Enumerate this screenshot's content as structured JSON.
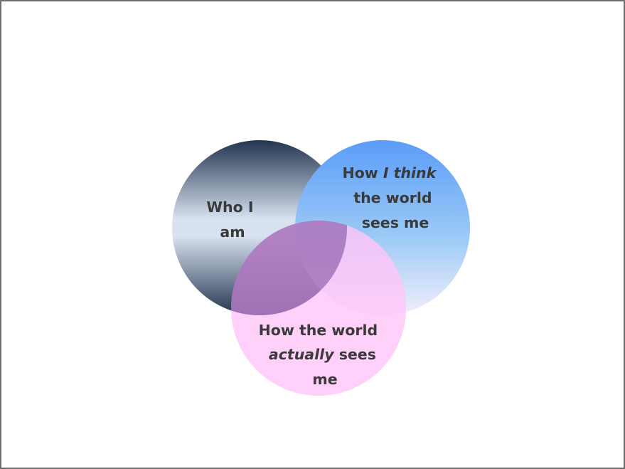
{
  "diagram": {
    "circles": [
      {
        "id": "who-i-am",
        "lines": [
          [
            {
              "text": "Who I",
              "italic": false
            }
          ],
          [
            {
              "text": "am",
              "italic": false
            }
          ]
        ],
        "colors": [
          "#22344f",
          "#d7e1ef",
          "#22344f"
        ]
      },
      {
        "id": "think-world-sees",
        "lines": [
          [
            {
              "text": "How ",
              "italic": false
            },
            {
              "text": "I think",
              "italic": true
            }
          ],
          [
            {
              "text": "the world",
              "italic": false
            }
          ],
          [
            {
              "text": "sees me",
              "italic": false
            }
          ]
        ],
        "colors": [
          "#5a9cf8",
          "#9ccaf6",
          "#f2eefb"
        ]
      },
      {
        "id": "actually-world-sees",
        "lines": [
          [
            {
              "text": "How the world",
              "italic": false
            }
          ],
          [
            {
              "text": "actually",
              "italic": true
            },
            {
              "text": " sees",
              "italic": false
            }
          ],
          [
            {
              "text": "me",
              "italic": false
            }
          ]
        ],
        "colors": [
          "#ffc6f8",
          "#ffc6f8"
        ]
      }
    ]
  }
}
